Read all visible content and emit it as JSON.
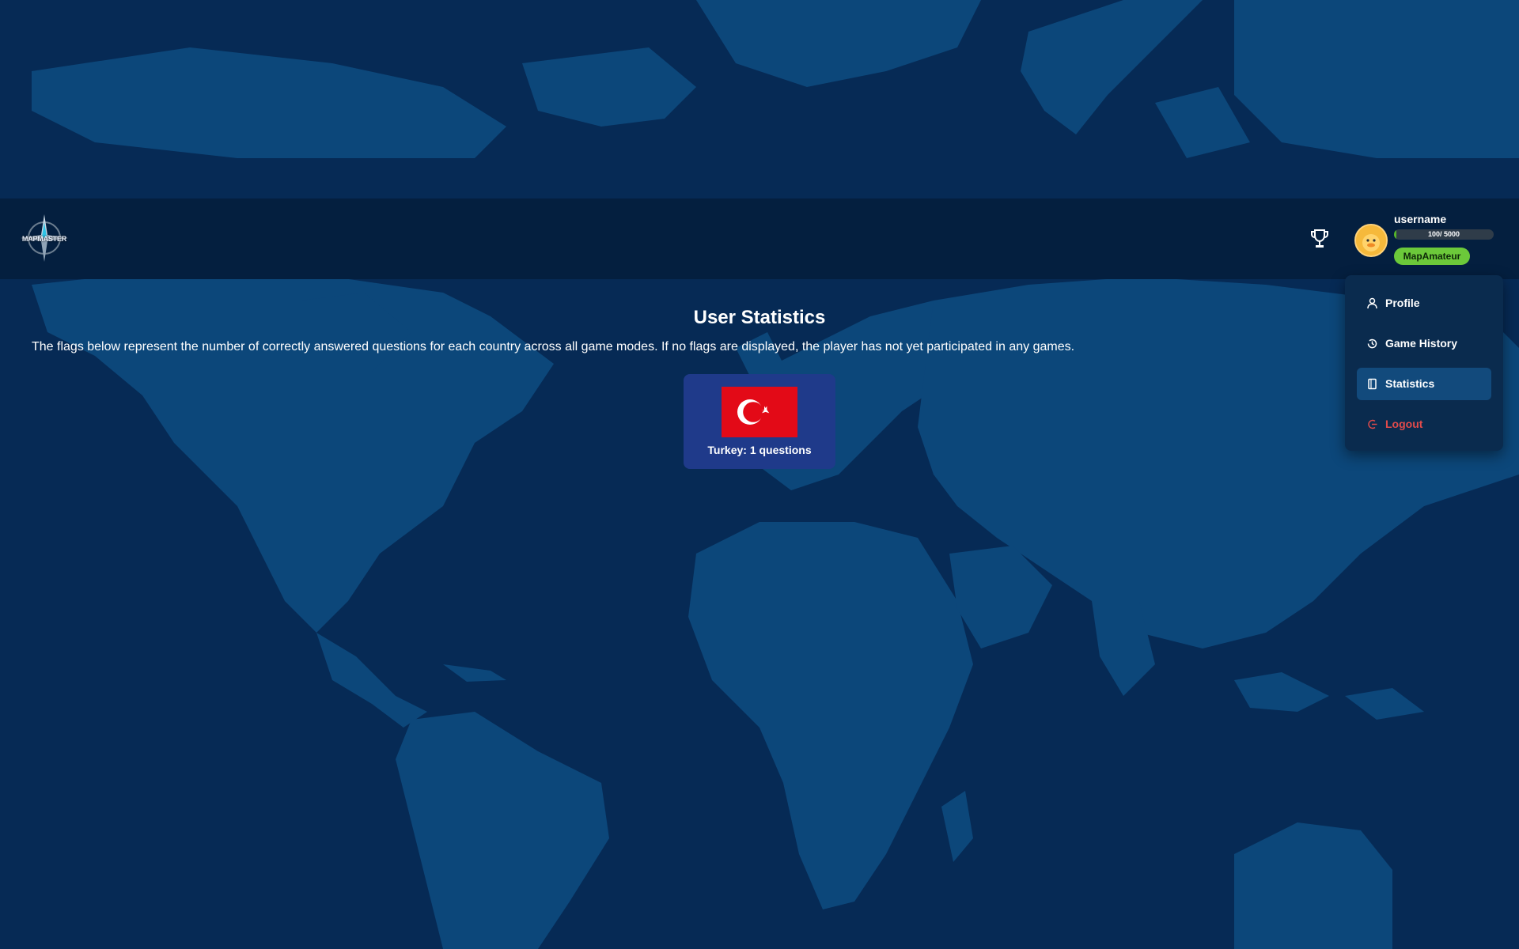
{
  "app": {
    "logo_text": "MAPMASTER"
  },
  "header": {
    "username": "username",
    "xp_text": "100/ 5000",
    "xp_progress": 0.02,
    "rank": "MapAmateur"
  },
  "main": {
    "title": "User Statistics",
    "description": "The flags below represent the number of correctly answered questions for each country across all game modes. If no flags are displayed, the player has not yet participated in any games.",
    "flags": [
      {
        "country": "Turkey",
        "label": "Turkey: 1 questions",
        "flag_icon": "turkey-flag-icon"
      }
    ]
  },
  "menu": {
    "items": [
      {
        "label": "Profile",
        "icon": "user-icon"
      },
      {
        "label": "Game History",
        "icon": "history-icon"
      },
      {
        "label": "Statistics",
        "icon": "book-icon",
        "active": true
      },
      {
        "label": "Logout",
        "icon": "logout-icon"
      }
    ]
  },
  "colors": {
    "background": "#062a55",
    "land": "#0c477a",
    "navbar": "#041f3f",
    "dropdown": "#0a2b4e",
    "active_item": "#124a7c",
    "flag_card": "#1f3a8a",
    "rank_badge": "#6cc93a",
    "xp_fill": "#55b52a",
    "logout": "#e24b4b"
  }
}
